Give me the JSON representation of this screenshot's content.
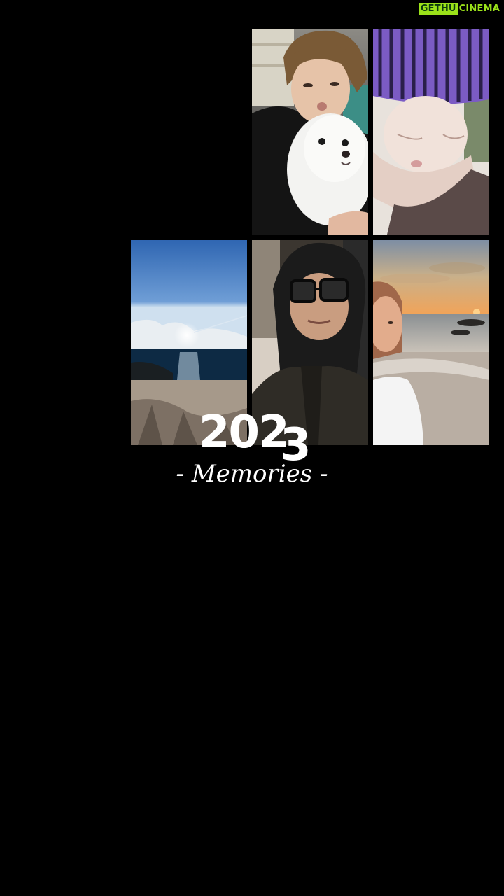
{
  "watermark": {
    "part1": "GETHU",
    "part2": "CINEMA"
  },
  "title": {
    "year_lead": "202",
    "year_last": "3",
    "subtitle": "- Memories -"
  },
  "photos": [
    {
      "name": "selfie-with-white-dog"
    },
    {
      "name": "beanie-portrait"
    },
    {
      "name": "sky-and-sea"
    },
    {
      "name": "hooded-selfie-glasses"
    },
    {
      "name": "sunset-beach-selfie"
    }
  ],
  "colors": {
    "background": "#000000",
    "watermark_green": "#9be21a"
  }
}
